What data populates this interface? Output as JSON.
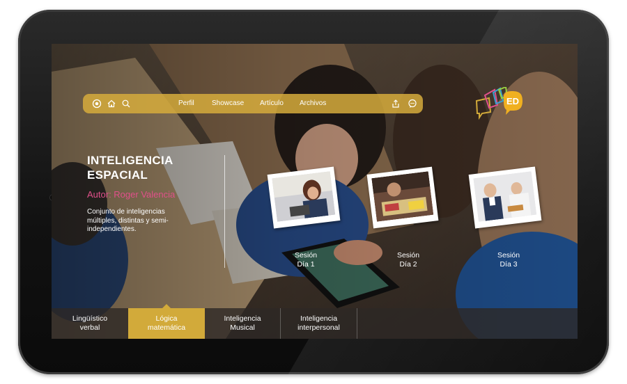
{
  "topbar": {
    "nav": [
      "Perfil",
      "Showcase",
      "Artículo",
      "Archivos"
    ],
    "icons": [
      "record-icon",
      "home-icon",
      "search-icon",
      "share-icon",
      "chat-icon"
    ]
  },
  "logo": {
    "text": "ED"
  },
  "article": {
    "title_line1": "INTELIGENCIA",
    "title_line2": "ESPACIAL",
    "author": "Autor: Roger Valencia",
    "description": "Conjunto de inteligencias múltiples, distintas y semi-independientes."
  },
  "sessions": [
    {
      "line1": "Sesión",
      "line2": "Día 1"
    },
    {
      "line1": "Sesión",
      "line2": "Día 2"
    },
    {
      "line1": "Sesión",
      "line2": "Día 3"
    }
  ],
  "tabs": [
    {
      "line1": "Lingüístico",
      "line2": "verbal"
    },
    {
      "line1": "Lógica",
      "line2": "matemática"
    },
    {
      "line1": "Inteligencia",
      "line2": "Musical"
    },
    {
      "line1": "Inteligencia",
      "line2": "interpersonal"
    }
  ],
  "active_tab": 1,
  "colors": {
    "accent": "#d2aa3a",
    "author": "#e0508a",
    "bar": "#d6ac3c"
  }
}
